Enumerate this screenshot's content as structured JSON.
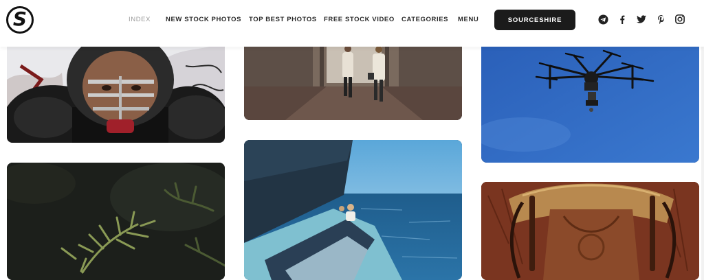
{
  "brand": {
    "logo_letter": "S"
  },
  "nav": {
    "items": [
      {
        "label": "INDEX",
        "active": true
      },
      {
        "label": "NEW STOCK PHOTOS",
        "active": false
      },
      {
        "label": "TOP BEST PHOTOS",
        "active": false
      },
      {
        "label": "FREE STOCK VIDEO",
        "active": false
      },
      {
        "label": "CATEGORIES",
        "active": false
      },
      {
        "label": "MENU",
        "active": false
      }
    ],
    "cta_label": "SOURCESHIRE"
  },
  "social_icons": [
    "telegram-icon",
    "facebook-icon",
    "twitter-icon",
    "pinterest-icon",
    "instagram-icon"
  ],
  "photos": [
    {
      "name": "photo-football-player",
      "subject": "football-player"
    },
    {
      "name": "photo-street-walkers",
      "subject": "street-walkers"
    },
    {
      "name": "photo-drone",
      "subject": "drone"
    },
    {
      "name": "photo-pine-branch",
      "subject": "pine-branch"
    },
    {
      "name": "photo-sailboat",
      "subject": "sailboat"
    },
    {
      "name": "photo-saddle",
      "subject": "saddle"
    }
  ],
  "colors": {
    "cta_bg": "#1b1b1b",
    "nav_active": "#9a9a9a",
    "nav_text": "#2a2a2a"
  }
}
